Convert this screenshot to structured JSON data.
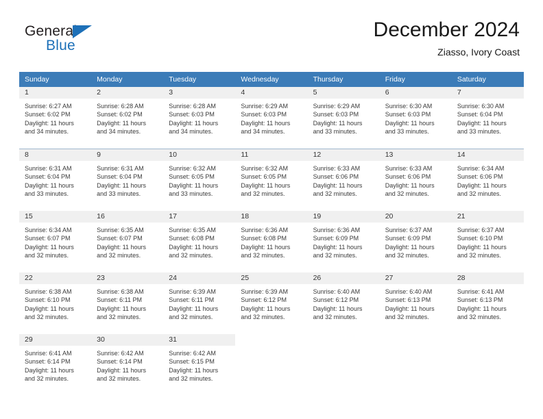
{
  "brand": {
    "name_part1": "General",
    "name_part2": "Blue",
    "triangle_color": "#1d70b8"
  },
  "header": {
    "title": "December 2024",
    "subtitle": "Ziasso, Ivory Coast",
    "accent_color": "#3c7cb8"
  },
  "weekdays": [
    "Sunday",
    "Monday",
    "Tuesday",
    "Wednesday",
    "Thursday",
    "Friday",
    "Saturday"
  ],
  "weeks": [
    [
      {
        "day": "1",
        "sunrise": "Sunrise: 6:27 AM",
        "sunset": "Sunset: 6:02 PM",
        "daylight_line1": "Daylight: 11 hours",
        "daylight_line2": "and 34 minutes."
      },
      {
        "day": "2",
        "sunrise": "Sunrise: 6:28 AM",
        "sunset": "Sunset: 6:02 PM",
        "daylight_line1": "Daylight: 11 hours",
        "daylight_line2": "and 34 minutes."
      },
      {
        "day": "3",
        "sunrise": "Sunrise: 6:28 AM",
        "sunset": "Sunset: 6:03 PM",
        "daylight_line1": "Daylight: 11 hours",
        "daylight_line2": "and 34 minutes."
      },
      {
        "day": "4",
        "sunrise": "Sunrise: 6:29 AM",
        "sunset": "Sunset: 6:03 PM",
        "daylight_line1": "Daylight: 11 hours",
        "daylight_line2": "and 34 minutes."
      },
      {
        "day": "5",
        "sunrise": "Sunrise: 6:29 AM",
        "sunset": "Sunset: 6:03 PM",
        "daylight_line1": "Daylight: 11 hours",
        "daylight_line2": "and 33 minutes."
      },
      {
        "day": "6",
        "sunrise": "Sunrise: 6:30 AM",
        "sunset": "Sunset: 6:03 PM",
        "daylight_line1": "Daylight: 11 hours",
        "daylight_line2": "and 33 minutes."
      },
      {
        "day": "7",
        "sunrise": "Sunrise: 6:30 AM",
        "sunset": "Sunset: 6:04 PM",
        "daylight_line1": "Daylight: 11 hours",
        "daylight_line2": "and 33 minutes."
      }
    ],
    [
      {
        "day": "8",
        "sunrise": "Sunrise: 6:31 AM",
        "sunset": "Sunset: 6:04 PM",
        "daylight_line1": "Daylight: 11 hours",
        "daylight_line2": "and 33 minutes."
      },
      {
        "day": "9",
        "sunrise": "Sunrise: 6:31 AM",
        "sunset": "Sunset: 6:04 PM",
        "daylight_line1": "Daylight: 11 hours",
        "daylight_line2": "and 33 minutes."
      },
      {
        "day": "10",
        "sunrise": "Sunrise: 6:32 AM",
        "sunset": "Sunset: 6:05 PM",
        "daylight_line1": "Daylight: 11 hours",
        "daylight_line2": "and 33 minutes."
      },
      {
        "day": "11",
        "sunrise": "Sunrise: 6:32 AM",
        "sunset": "Sunset: 6:05 PM",
        "daylight_line1": "Daylight: 11 hours",
        "daylight_line2": "and 32 minutes."
      },
      {
        "day": "12",
        "sunrise": "Sunrise: 6:33 AM",
        "sunset": "Sunset: 6:06 PM",
        "daylight_line1": "Daylight: 11 hours",
        "daylight_line2": "and 32 minutes."
      },
      {
        "day": "13",
        "sunrise": "Sunrise: 6:33 AM",
        "sunset": "Sunset: 6:06 PM",
        "daylight_line1": "Daylight: 11 hours",
        "daylight_line2": "and 32 minutes."
      },
      {
        "day": "14",
        "sunrise": "Sunrise: 6:34 AM",
        "sunset": "Sunset: 6:06 PM",
        "daylight_line1": "Daylight: 11 hours",
        "daylight_line2": "and 32 minutes."
      }
    ],
    [
      {
        "day": "15",
        "sunrise": "Sunrise: 6:34 AM",
        "sunset": "Sunset: 6:07 PM",
        "daylight_line1": "Daylight: 11 hours",
        "daylight_line2": "and 32 minutes."
      },
      {
        "day": "16",
        "sunrise": "Sunrise: 6:35 AM",
        "sunset": "Sunset: 6:07 PM",
        "daylight_line1": "Daylight: 11 hours",
        "daylight_line2": "and 32 minutes."
      },
      {
        "day": "17",
        "sunrise": "Sunrise: 6:35 AM",
        "sunset": "Sunset: 6:08 PM",
        "daylight_line1": "Daylight: 11 hours",
        "daylight_line2": "and 32 minutes."
      },
      {
        "day": "18",
        "sunrise": "Sunrise: 6:36 AM",
        "sunset": "Sunset: 6:08 PM",
        "daylight_line1": "Daylight: 11 hours",
        "daylight_line2": "and 32 minutes."
      },
      {
        "day": "19",
        "sunrise": "Sunrise: 6:36 AM",
        "sunset": "Sunset: 6:09 PM",
        "daylight_line1": "Daylight: 11 hours",
        "daylight_line2": "and 32 minutes."
      },
      {
        "day": "20",
        "sunrise": "Sunrise: 6:37 AM",
        "sunset": "Sunset: 6:09 PM",
        "daylight_line1": "Daylight: 11 hours",
        "daylight_line2": "and 32 minutes."
      },
      {
        "day": "21",
        "sunrise": "Sunrise: 6:37 AM",
        "sunset": "Sunset: 6:10 PM",
        "daylight_line1": "Daylight: 11 hours",
        "daylight_line2": "and 32 minutes."
      }
    ],
    [
      {
        "day": "22",
        "sunrise": "Sunrise: 6:38 AM",
        "sunset": "Sunset: 6:10 PM",
        "daylight_line1": "Daylight: 11 hours",
        "daylight_line2": "and 32 minutes."
      },
      {
        "day": "23",
        "sunrise": "Sunrise: 6:38 AM",
        "sunset": "Sunset: 6:11 PM",
        "daylight_line1": "Daylight: 11 hours",
        "daylight_line2": "and 32 minutes."
      },
      {
        "day": "24",
        "sunrise": "Sunrise: 6:39 AM",
        "sunset": "Sunset: 6:11 PM",
        "daylight_line1": "Daylight: 11 hours",
        "daylight_line2": "and 32 minutes."
      },
      {
        "day": "25",
        "sunrise": "Sunrise: 6:39 AM",
        "sunset": "Sunset: 6:12 PM",
        "daylight_line1": "Daylight: 11 hours",
        "daylight_line2": "and 32 minutes."
      },
      {
        "day": "26",
        "sunrise": "Sunrise: 6:40 AM",
        "sunset": "Sunset: 6:12 PM",
        "daylight_line1": "Daylight: 11 hours",
        "daylight_line2": "and 32 minutes."
      },
      {
        "day": "27",
        "sunrise": "Sunrise: 6:40 AM",
        "sunset": "Sunset: 6:13 PM",
        "daylight_line1": "Daylight: 11 hours",
        "daylight_line2": "and 32 minutes."
      },
      {
        "day": "28",
        "sunrise": "Sunrise: 6:41 AM",
        "sunset": "Sunset: 6:13 PM",
        "daylight_line1": "Daylight: 11 hours",
        "daylight_line2": "and 32 minutes."
      }
    ],
    [
      {
        "day": "29",
        "sunrise": "Sunrise: 6:41 AM",
        "sunset": "Sunset: 6:14 PM",
        "daylight_line1": "Daylight: 11 hours",
        "daylight_line2": "and 32 minutes."
      },
      {
        "day": "30",
        "sunrise": "Sunrise: 6:42 AM",
        "sunset": "Sunset: 6:14 PM",
        "daylight_line1": "Daylight: 11 hours",
        "daylight_line2": "and 32 minutes."
      },
      {
        "day": "31",
        "sunrise": "Sunrise: 6:42 AM",
        "sunset": "Sunset: 6:15 PM",
        "daylight_line1": "Daylight: 11 hours",
        "daylight_line2": "and 32 minutes."
      },
      {
        "day": "",
        "sunrise": "",
        "sunset": "",
        "daylight_line1": "",
        "daylight_line2": ""
      },
      {
        "day": "",
        "sunrise": "",
        "sunset": "",
        "daylight_line1": "",
        "daylight_line2": ""
      },
      {
        "day": "",
        "sunrise": "",
        "sunset": "",
        "daylight_line1": "",
        "daylight_line2": ""
      },
      {
        "day": "",
        "sunrise": "",
        "sunset": "",
        "daylight_line1": "",
        "daylight_line2": ""
      }
    ]
  ]
}
